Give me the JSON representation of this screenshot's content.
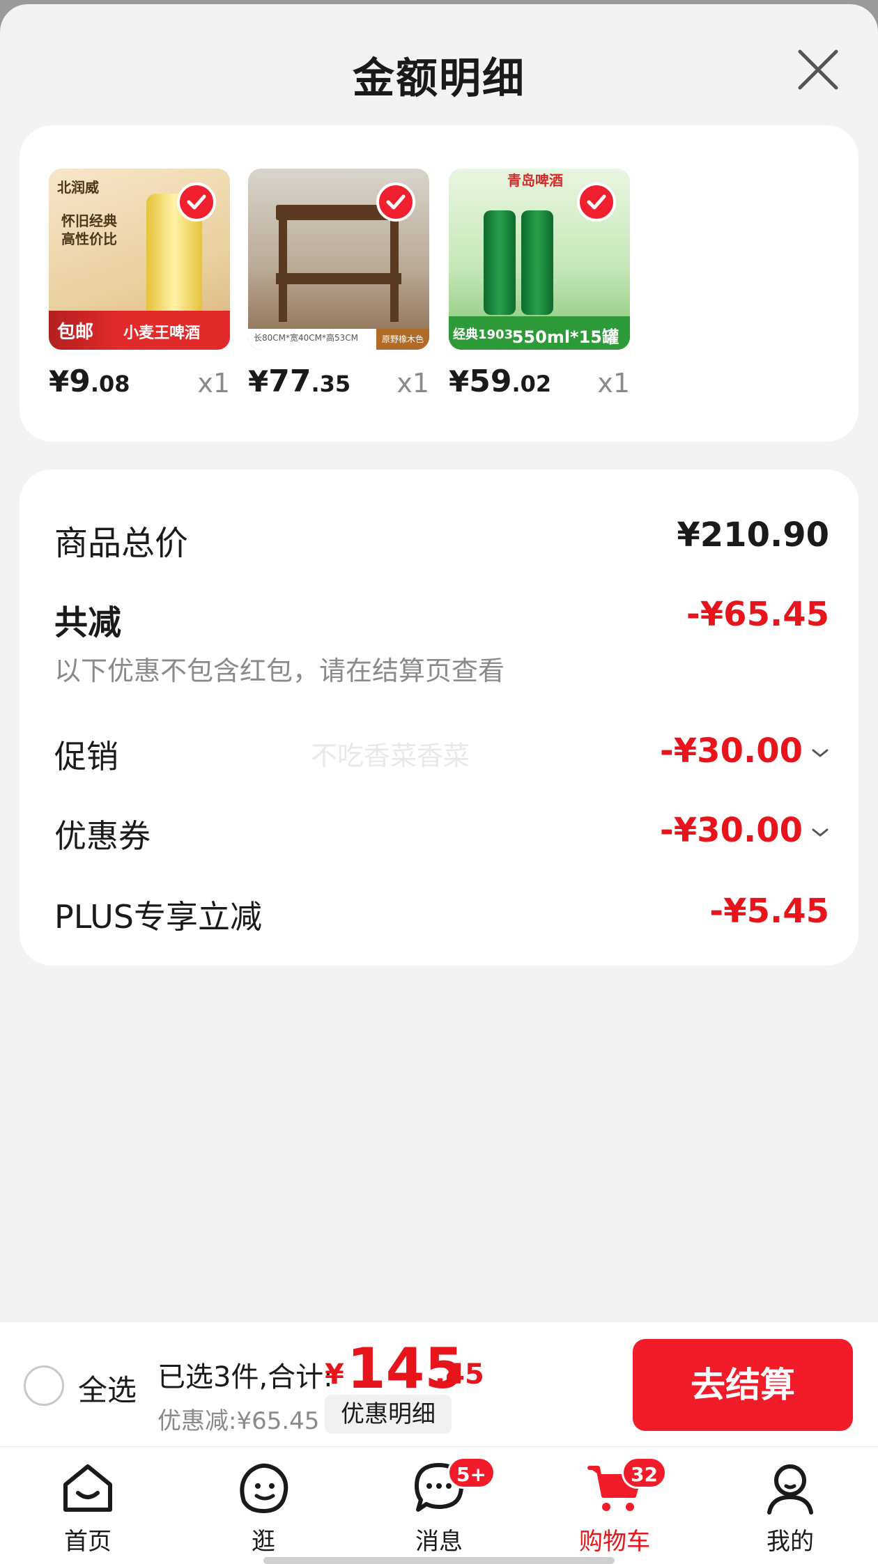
{
  "header": {
    "title": "金额明细"
  },
  "products": [
    {
      "name": "小麦王啤酒",
      "price_currency": "¥",
      "price_int": "9",
      "price_dec": ".08",
      "qty": "x1",
      "thumb_brand": "北润威",
      "thumb_slogan_1": "怀旧经典",
      "thumb_slogan_2": "高性价比",
      "thumb_tag": "包邮",
      "thumb_banner": "小麦王啤酒"
    },
    {
      "name": "边几茶几",
      "price_currency": "¥",
      "price_int": "77",
      "price_dec": ".35",
      "qty": "x1",
      "thumb_spec": "长80CM*宽40CM*高53CM",
      "thumb_color": "原野橡木色"
    },
    {
      "name": "青岛啤酒",
      "price_currency": "¥",
      "price_int": "59",
      "price_dec": ".02",
      "qty": "x1",
      "thumb_brand": "青岛啤酒",
      "thumb_series": "经典1903",
      "thumb_banner": "550ml*15罐"
    }
  ],
  "summary": {
    "total_label": "商品总价",
    "total_value": "¥210.90",
    "reduce_label": "共减",
    "reduce_value": "-¥65.45",
    "hint": "以下优惠不包含红包，请在结算页查看",
    "promo_label": "促销",
    "promo_value": "-¥30.00",
    "coupon_label": "优惠券",
    "coupon_value": "-¥30.00",
    "plus_label": "PLUS专享立减",
    "plus_value": "-¥5.45"
  },
  "watermark": "不吃香菜香菜",
  "checkout": {
    "select_all": "全选",
    "selected_text": "已选3件,合计:",
    "total_currency": "¥",
    "total_int": "145",
    "total_dec": ".45",
    "discount_text": "优惠减:¥65.45",
    "detail_button": "优惠明细",
    "checkout_button": "去结算"
  },
  "tabbar": {
    "items": [
      {
        "label": "首页",
        "icon": "home-icon"
      },
      {
        "label": "逛",
        "icon": "browse-icon"
      },
      {
        "label": "消息",
        "icon": "message-icon",
        "badge": "5+"
      },
      {
        "label": "购物车",
        "icon": "cart-icon",
        "badge": "32",
        "active": true
      },
      {
        "label": "我的",
        "icon": "profile-icon"
      }
    ]
  },
  "colors": {
    "accent": "#e8141c",
    "button": "#f11b29"
  }
}
